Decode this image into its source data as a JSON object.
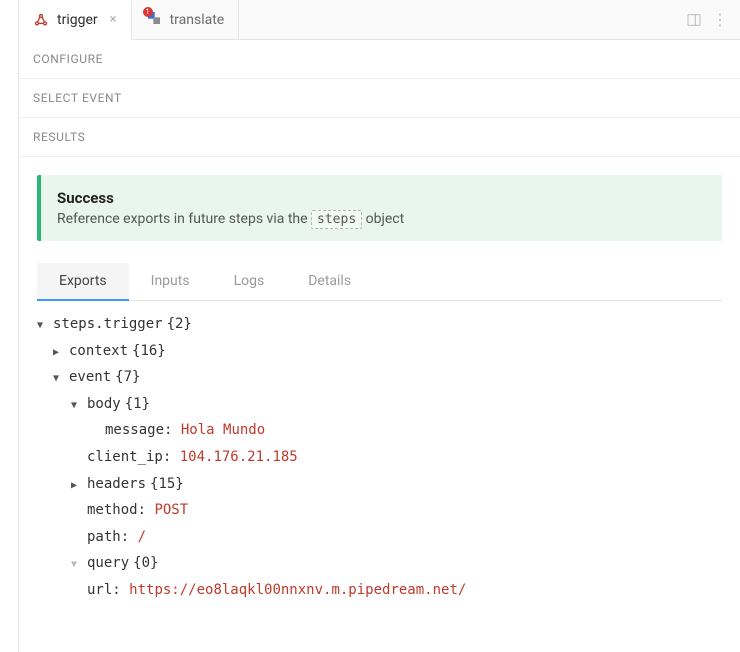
{
  "tabs": {
    "trigger": "trigger",
    "translate": "translate",
    "translate_badge": "1"
  },
  "sections": {
    "configure": "CONFIGURE",
    "select_event": "SELECT EVENT",
    "results": "RESULTS"
  },
  "banner": {
    "title": "Success",
    "prefix": "Reference exports in future steps via the",
    "code": "steps",
    "suffix": "object"
  },
  "subtabs": {
    "exports": "Exports",
    "inputs": "Inputs",
    "logs": "Logs",
    "details": "Details"
  },
  "tree": {
    "root_key": "steps.trigger",
    "root_count": "{2}",
    "context_key": "context",
    "context_count": "{16}",
    "event_key": "event",
    "event_count": "{7}",
    "body_key": "body",
    "body_count": "{1}",
    "message_key": "message:",
    "message_val": "Hola Mundo",
    "clientip_key": "client_ip:",
    "clientip_val": "104.176.21.185",
    "headers_key": "headers",
    "headers_count": "{15}",
    "method_key": "method:",
    "method_val": "POST",
    "path_key": "path:",
    "path_val": "/",
    "query_key": "query",
    "query_count": "{0}",
    "url_key": "url:",
    "url_val": "https://eo8laqkl00nnxnv.m.pipedream.net/"
  }
}
